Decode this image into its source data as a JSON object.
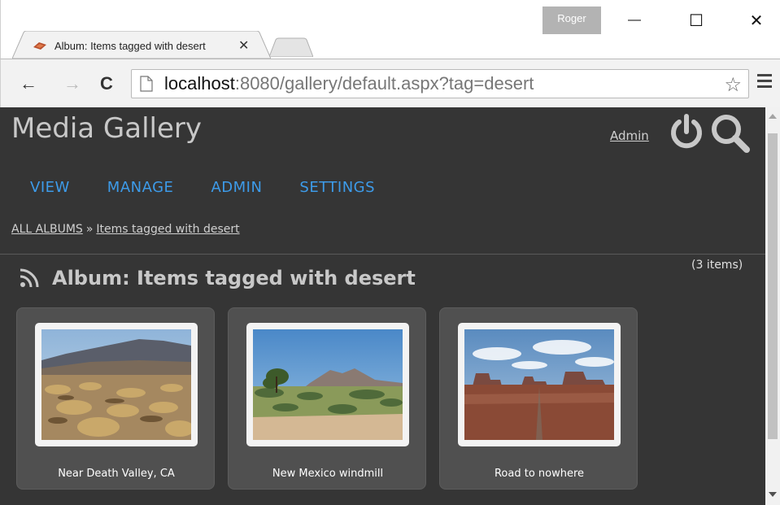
{
  "window": {
    "user_badge": "Roger",
    "min_glyph": "—",
    "max_glyph": "☐",
    "close_glyph": "✕"
  },
  "tab": {
    "title": "Album: Items tagged with desert",
    "close_glyph": "✕"
  },
  "toolbar": {
    "back_glyph": "←",
    "forward_glyph": "→",
    "reload_glyph": "C",
    "url_host": "localhost",
    "url_rest": ":8080/gallery/default.aspx?tag=desert",
    "star_glyph": "☆"
  },
  "header": {
    "site_title": "Media Gallery",
    "admin_link": "Admin"
  },
  "menu": {
    "items": [
      "VIEW",
      "MANAGE",
      "ADMIN",
      "SETTINGS"
    ]
  },
  "breadcrumb": {
    "root": "ALL ALBUMS",
    "separator": "»",
    "current": "Items tagged with desert"
  },
  "album": {
    "title": "Album: Items tagged with desert",
    "item_count": "(3 items)",
    "items": [
      {
        "caption": "Near Death Valley, CA"
      },
      {
        "caption": "New Mexico windmill"
      },
      {
        "caption": "Road to nowhere"
      }
    ]
  },
  "colors": {
    "page_bg": "#353535",
    "menu_link": "#3d9be9",
    "card_bg": "#505050",
    "text_light": "#c8c8c8"
  },
  "icons": [
    "favicon-icon",
    "page-icon",
    "star-icon",
    "menu-icon",
    "power-icon",
    "search-icon",
    "rss-icon"
  ]
}
